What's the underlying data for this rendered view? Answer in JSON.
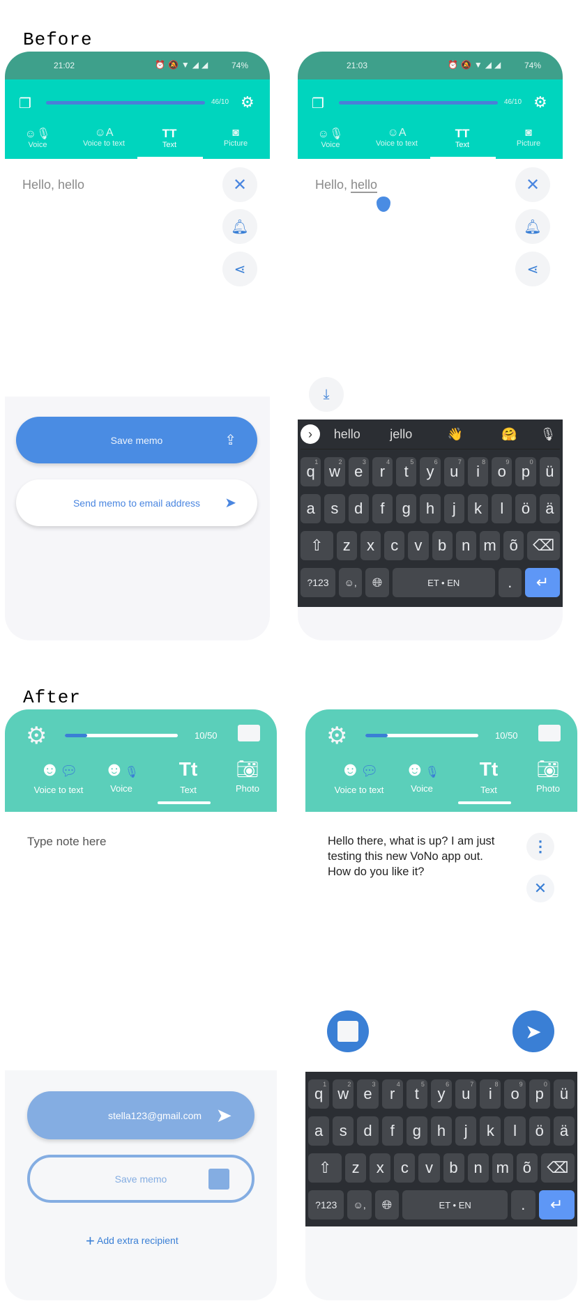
{
  "labels": {
    "before": "Before",
    "after": "After"
  },
  "before": {
    "screens": [
      {
        "time": "21:02",
        "battery": "74%",
        "counter": "46/10",
        "note": "Hello, hello"
      },
      {
        "time": "21:03",
        "battery": "74%",
        "counter": "46/10",
        "note_a": "Hello, ",
        "note_b": "hello"
      }
    ],
    "tabs": [
      "Voice",
      "Voice to text",
      "Text",
      "Picture"
    ],
    "save_memo": "Save memo",
    "send_email": "Send memo to email address",
    "suggestions": [
      "hello",
      "jello",
      "👋",
      "🤗"
    ]
  },
  "after": {
    "counter": "10/50",
    "progress": 0.2,
    "tabs": [
      "Voice to text",
      "Voice",
      "Text",
      "Photo"
    ],
    "placeholder": "Type note here",
    "note": "Hello there, what is up? I am just testing this new VoNo app out. How do you like it?",
    "email": "stella123@gmail.com",
    "save_memo": "Save memo",
    "add_recipient": "Add extra recipient"
  },
  "keyboard": {
    "row1": [
      "q",
      "w",
      "e",
      "r",
      "t",
      "y",
      "u",
      "i",
      "o",
      "p",
      "ü"
    ],
    "nums": [
      "1",
      "2",
      "3",
      "4",
      "5",
      "6",
      "7",
      "8",
      "9",
      "0",
      ""
    ],
    "row2": [
      "a",
      "s",
      "d",
      "f",
      "g",
      "h",
      "j",
      "k",
      "l",
      "ö",
      "ä"
    ],
    "row3": [
      "z",
      "x",
      "c",
      "v",
      "b",
      "n",
      "m",
      "õ"
    ],
    "sym": "?123",
    "space": "ET • EN",
    "period": "."
  },
  "colors": {
    "accent": "#3a7fd5",
    "teal": "#00d5be",
    "teal_after": "#5bcfba"
  }
}
